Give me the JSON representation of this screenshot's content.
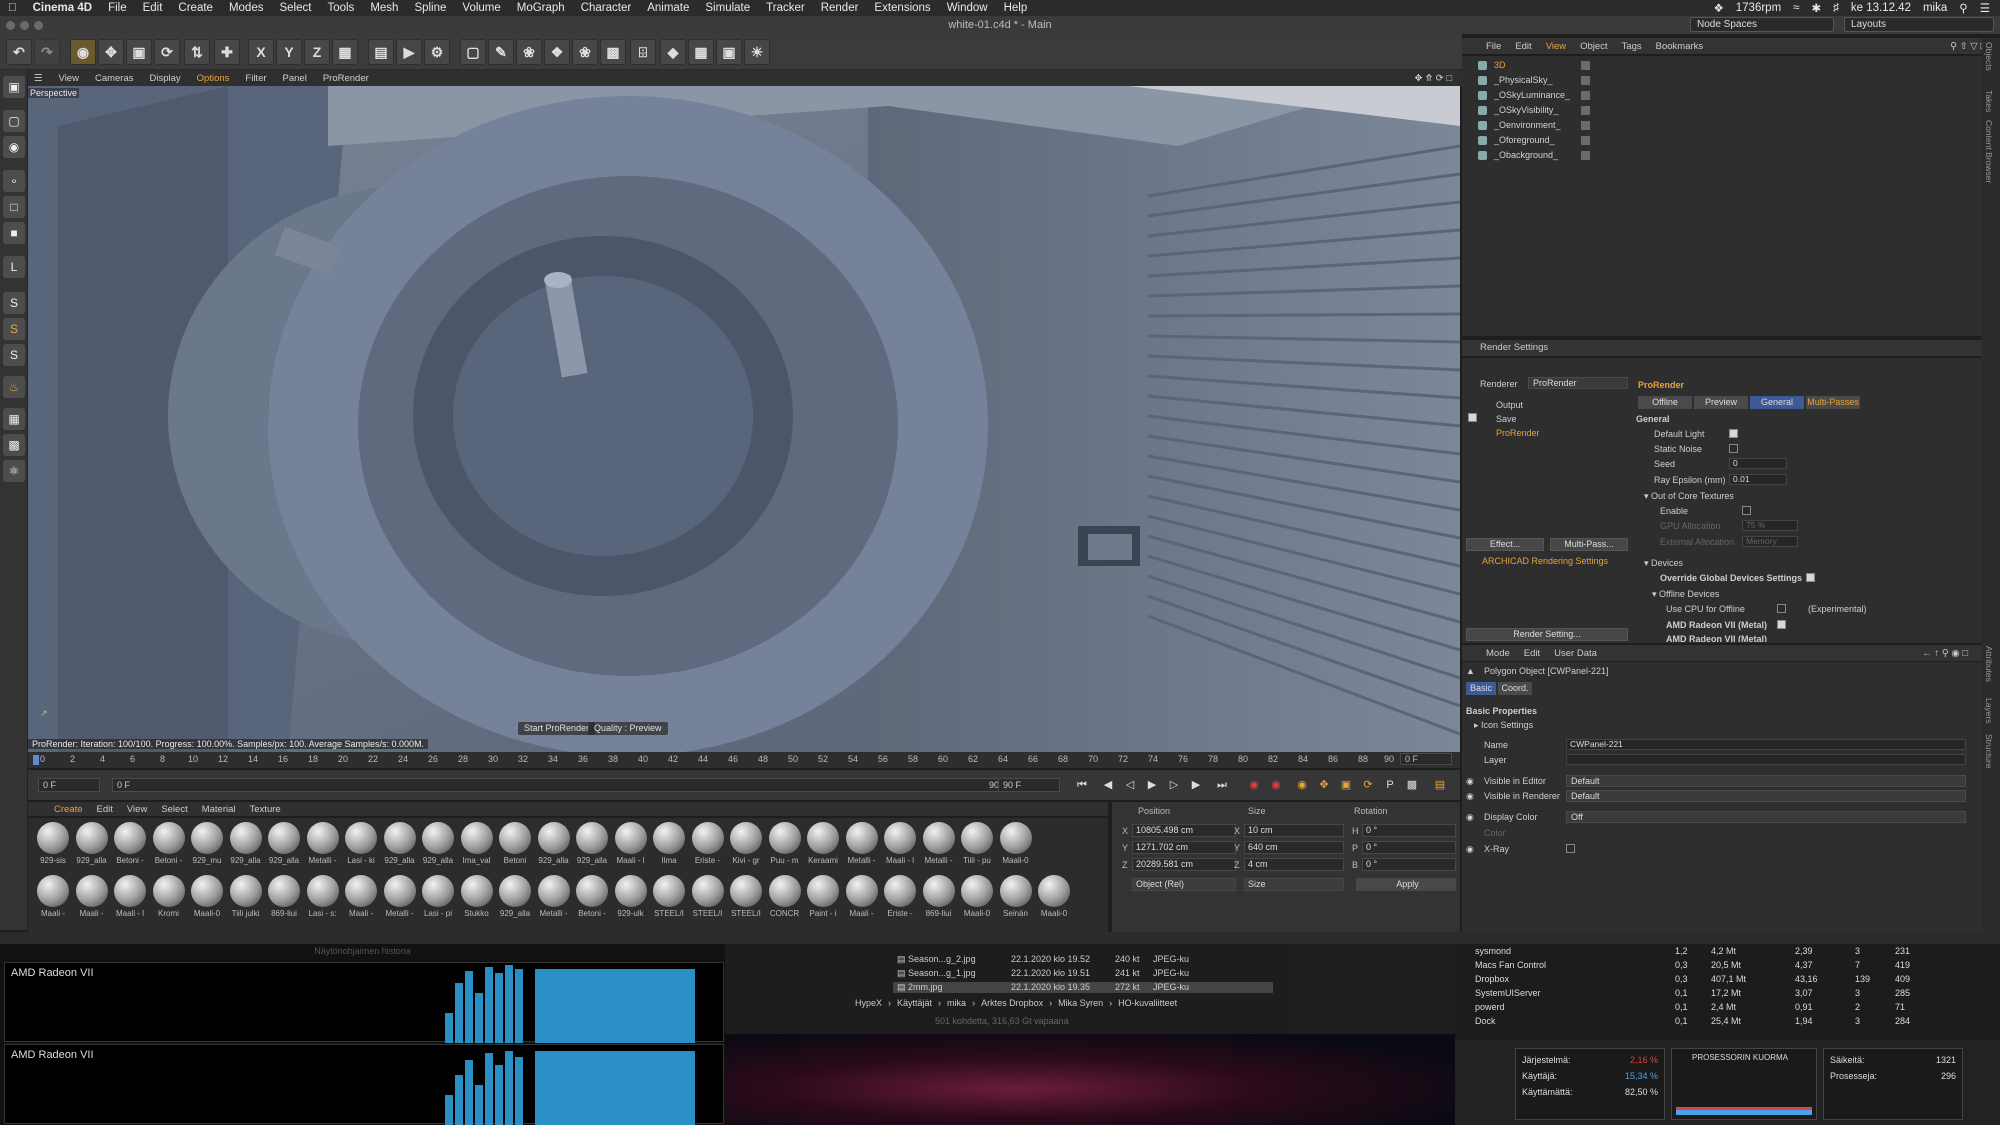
{
  "menubar": {
    "app": "Cinema 4D",
    "items": [
      "File",
      "Edit",
      "Create",
      "Modes",
      "Select",
      "Tools",
      "Mesh",
      "Spline",
      "Volume",
      "MoGraph",
      "Character",
      "Animate",
      "Simulate",
      "Tracker",
      "Render",
      "Extensions",
      "Window",
      "Help"
    ],
    "rpm": "1736rpm",
    "clock": "ke 13.12.42",
    "user": "mika"
  },
  "window": {
    "title": "white-01.c4d * - Main",
    "node_spaces": "Node Spaces",
    "layouts": "Layouts"
  },
  "viewport": {
    "menu": [
      "View",
      "Cameras",
      "Display",
      "Options",
      "Filter",
      "Panel",
      "ProRender"
    ],
    "camera_label": "Perspective",
    "status": "ProRender: Iteration: 100/100. Progress: 100.00%. Samples/px: 100. Average Samples/s: 0.000M.",
    "start_btn": "Start ProRender",
    "quality_btn": "Quality : Preview"
  },
  "timeline": {
    "ticks": [
      "0",
      "2",
      "4",
      "6",
      "8",
      "10",
      "12",
      "14",
      "16",
      "18",
      "20",
      "22",
      "24",
      "26",
      "28",
      "30",
      "32",
      "34",
      "36",
      "38",
      "40",
      "42",
      "44",
      "46",
      "48",
      "50",
      "52",
      "54",
      "56",
      "58",
      "60",
      "62",
      "64",
      "66",
      "68",
      "70",
      "72",
      "74",
      "76",
      "78",
      "80",
      "82",
      "84",
      "86",
      "88",
      "90"
    ],
    "current": "0 F",
    "start": "0 F",
    "start2": "0 F",
    "end": "90 F",
    "end2": "90 F"
  },
  "materials": {
    "menu": [
      "Create",
      "Edit",
      "View",
      "Select",
      "Material",
      "Texture"
    ],
    "row1": [
      "929-sis",
      "929_alla",
      "Betoni -",
      "Betoni -",
      "929_mu",
      "929_alla",
      "929_alla",
      "Metalli -",
      "Lasi - ki",
      "929_alla",
      "929_alla",
      "Ima_val",
      "Betoni",
      "929_alla",
      "929_alla",
      "Maali - l",
      "Ilma",
      "Eriste -",
      "Kivi - gr",
      "Puu - m",
      "Keraami",
      "Metalli -",
      "Maali - l",
      "Metalli -",
      "Tiili - pu",
      "Maali-0"
    ],
    "row2": [
      "Maali -",
      "Maali -",
      "Maali - l",
      "Kromi",
      "Maali-0",
      "Tiili julki",
      "869-liui",
      "Lasi - s:",
      "Maali -",
      "Metalli -",
      "Lasi - pi",
      "Stukko",
      "929_alla",
      "Metalli -",
      "Betoni -",
      "929-ulk",
      "STEEL/I",
      "STEEL/I",
      "STEEL/I",
      "CONCR",
      "Paint - i",
      "Maali -",
      "Eriste -",
      "869-liui",
      "Maali-0",
      "Seinän",
      "Maali-0"
    ]
  },
  "coords": {
    "headers": [
      "Position",
      "Size",
      "Rotation"
    ],
    "axes": [
      "X",
      "Y",
      "Z"
    ],
    "rot_axes": [
      "H",
      "P",
      "B"
    ],
    "pos": [
      "10805.498 cm",
      "1271.702 cm",
      "20289.581 cm"
    ],
    "size": [
      "10 cm",
      "640 cm",
      "4 cm"
    ],
    "rot": [
      "0 °",
      "0 °",
      "0 °"
    ],
    "mode": "Object (Rel)",
    "size_mode": "Size",
    "apply": "Apply"
  },
  "objects": {
    "menu": [
      "File",
      "Edit",
      "View",
      "Object",
      "Tags",
      "Bookmarks"
    ],
    "items": [
      "3D",
      "_PhysicalSky_",
      "_OSkyLuminance_",
      "_OSkyVisibility_",
      "_Oenvironment_",
      "_Oforeground_",
      "_Obackground_"
    ]
  },
  "render_settings": {
    "title": "Render Settings",
    "renderer_label": "Renderer",
    "renderer": "ProRender",
    "tree": [
      "Output",
      "Save",
      "ProRender"
    ],
    "effect_btn": "Effect...",
    "multipass_btn": "Multi-Pass...",
    "archicad": "ARCHICAD Rendering Settings",
    "render_setting_btn": "Render Setting...",
    "panel_title": "ProRender",
    "tabs": [
      "Offline",
      "Preview",
      "General",
      "Multi-Passes"
    ],
    "section": "General",
    "default_light": "Default Light",
    "static_noise": "Static Noise",
    "seed_label": "Seed",
    "seed": "0",
    "ray_eps_label": "Ray Epsilon (mm)",
    "ray_eps": "0.01",
    "ooc": "Out of Core Textures",
    "enable": "Enable",
    "gpu_alloc": "GPU Allocation",
    "gpu_alloc_val": "75 %",
    "ext_alloc": "External Allocation",
    "ext_alloc_val": "Memory",
    "devices": "Devices",
    "override": "Override Global Devices Settings",
    "offline_dev": "Offline Devices",
    "use_cpu": "Use CPU for Offline",
    "experimental": "(Experimental)",
    "gpu1": "AMD Radeon VII (Metal)",
    "gpu2": "AMD Radeon VII (Metal)"
  },
  "attributes": {
    "menu": [
      "Mode",
      "Edit",
      "User Data"
    ],
    "object": "Polygon Object [CWPanel-221]",
    "tabs": [
      "Basic",
      "Coord."
    ],
    "section": "Basic Properties",
    "icon_settings": "Icon Settings",
    "name_label": "Name",
    "name": "CWPanel-221",
    "layer_label": "Layer",
    "vis_editor": "Visible in Editor",
    "vis_renderer": "Visible in Renderer",
    "default": "Default",
    "display_color": "Display Color",
    "off": "Off",
    "color": "Color",
    "xray": "X-Ray"
  },
  "side_tabs": [
    "Objects",
    "Takes",
    "Content Browser",
    "Attributes",
    "Layers",
    "Structure"
  ],
  "gpu_history": {
    "title": "Näytönohjaimen historia",
    "label1": "AMD Radeon VII",
    "label2": "AMD Radeon VII"
  },
  "finder": {
    "files": [
      {
        "name": "Season...g_2.jpg",
        "date": "22.1.2020 klo 19.52",
        "size": "240 kt",
        "kind": "JPEG-ku"
      },
      {
        "name": "Season...g_1.jpg",
        "date": "22.1.2020 klo 19.51",
        "size": "241 kt",
        "kind": "JPEG-ku"
      },
      {
        "name": "2mm.jpg",
        "date": "22.1.2020 klo 19.35",
        "size": "272 kt",
        "kind": "JPEG-ku"
      }
    ],
    "path": [
      "HypeX",
      "Käyttäjät",
      "mika",
      "Arktes Dropbox",
      "Mika Syren",
      "HO-kuvaliitteet"
    ],
    "footer": "501 kohdetta, 316,63 Gt vapaana"
  },
  "activity": {
    "rows": [
      {
        "n": "sysmond",
        "a": "1,2",
        "b": "4,2 Mt",
        "c": "2,39",
        "d": "3",
        "e": "231"
      },
      {
        "n": "Macs Fan Control",
        "a": "0,3",
        "b": "20,5 Mt",
        "c": "4,37",
        "d": "7",
        "e": "419"
      },
      {
        "n": "Dropbox",
        "a": "0,3",
        "b": "407,1 Mt",
        "c": "43,16",
        "d": "139",
        "e": "409"
      },
      {
        "n": "SystemUIServer",
        "a": "0,1",
        "b": "17,2 Mt",
        "c": "3,07",
        "d": "3",
        "e": "285"
      },
      {
        "n": "powerd",
        "a": "0,1",
        "b": "2,4 Mt",
        "c": "0,91",
        "d": "2",
        "e": "71"
      },
      {
        "n": "Dock",
        "a": "0,1",
        "b": "25,4 Mt",
        "c": "1,94",
        "d": "3",
        "e": "284"
      }
    ],
    "system_label": "Järjestelmä:",
    "system": "2,16 %",
    "user_label": "Käyttäjä:",
    "user": "15,34 %",
    "idle_label": "Käyttämättä:",
    "idle": "82,50 %",
    "load_title": "PROSESSORIN KUORMA",
    "threads_label": "Säikeitä:",
    "threads": "1321",
    "procs_label": "Prosesseja:",
    "procs": "296"
  },
  "colors": {
    "accent": "#e8a33a",
    "active_tab": "#3c5a96",
    "ui_bg": "#2e2e2e"
  }
}
